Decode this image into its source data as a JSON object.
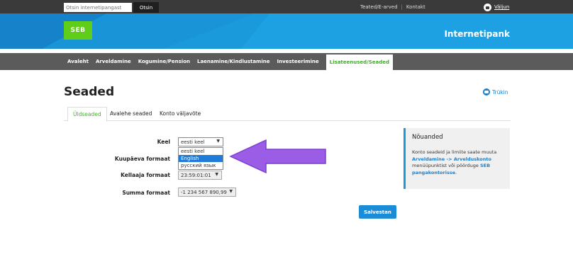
{
  "topbar": {
    "search_placeholder": "Otsin internetipangast",
    "search_button": "Otsin",
    "links": [
      "Teated/E-arved",
      "Kontakt"
    ],
    "logout": "Väljun"
  },
  "banner": {
    "logo": "SEB",
    "title": "Internetipank"
  },
  "nav": {
    "items": [
      "Avaleht",
      "Arveldamine",
      "Kogumine/Pension",
      "Laenamine/Kindlustamine",
      "Investeerimine",
      "Lisateenused/Seaded"
    ],
    "active_index": 5
  },
  "page": {
    "title": "Seaded",
    "print": "Trükin",
    "tabs": [
      "Üldseaded",
      "Avalehe seaded",
      "Konto väljavõte"
    ]
  },
  "form": {
    "language_label": "Keel",
    "language_value": "eesti keel",
    "language_options": [
      "eesti keel",
      "English",
      "русский язык"
    ],
    "language_highlight": "English",
    "date_label": "Kuupäeva formaat",
    "time_label": "Kellaaja formaat",
    "time_value": "23:59:01:01",
    "sum_label": "Summa formaat",
    "sum_value": "-1 234 567 890,99",
    "save": "Salvestan"
  },
  "advice": {
    "title": "Nõuanded",
    "text1": "Konto seadeid ja limiite saate muuta",
    "link1": "Arveldamine -> Arvelduskonto",
    "text2": "menüüpunktist või pöörduge",
    "link2a": "SEB",
    "link2b": "pangakontorisse",
    "text3": "."
  },
  "colors": {
    "brand_blue": "#1a9adb",
    "brand_green": "#60cd18",
    "active_green": "#41b02a",
    "arrow": "#9b5de5"
  }
}
